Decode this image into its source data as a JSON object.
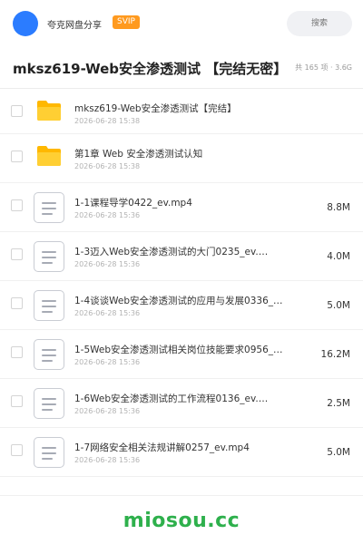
{
  "header": {
    "brand": "夸克网盘分享",
    "badge": "SVIP",
    "search_placeholder": "搜索",
    "accent_color": "#2b7cff",
    "badge_color": "#ff9a1f"
  },
  "folder": {
    "title": "mksz619-Web安全渗透测试 【完结无密】",
    "stats": "共 165 项 · 3.6G"
  },
  "files": [
    {
      "type": "folder",
      "icon": "folder-icon",
      "name": "mksz619-Web安全渗透测试【完结】",
      "date": "2026-06-28 15:38",
      "size": ""
    },
    {
      "type": "folder",
      "icon": "folder-icon",
      "name": "第1章 Web 安全渗透测试认知",
      "date": "2026-06-28 15:38",
      "size": ""
    },
    {
      "type": "file",
      "icon": "document-icon",
      "name": "1-1课程导学0422_ev.mp4",
      "date": "2026-06-28 15:36",
      "size": "8.8M"
    },
    {
      "type": "file",
      "icon": "document-icon",
      "name": "1-3迈入Web安全渗透测试的大门0235_ev.…",
      "date": "2026-06-28 15:36",
      "size": "4.0M"
    },
    {
      "type": "file",
      "icon": "document-icon",
      "name": "1-4谈谈Web安全渗透测试的应用与发展0336_…",
      "date": "2026-06-28 15:36",
      "size": "5.0M"
    },
    {
      "type": "file",
      "icon": "document-icon",
      "name": "1-5Web安全渗透测试相关岗位技能要求0956_…",
      "date": "2026-06-28 15:36",
      "size": "16.2M"
    },
    {
      "type": "file",
      "icon": "document-icon",
      "name": "1-6Web安全渗透测试的工作流程0136_ev.…",
      "date": "2026-06-28 15:36",
      "size": "2.5M"
    },
    {
      "type": "file",
      "icon": "document-icon",
      "name": "1-7网络安全相关法规讲解0257_ev.mp4",
      "date": "2026-06-28 15:36",
      "size": "5.0M"
    }
  ],
  "footer": {
    "watermark": "miosou.cc",
    "watermark_color": "#2eb04c"
  }
}
